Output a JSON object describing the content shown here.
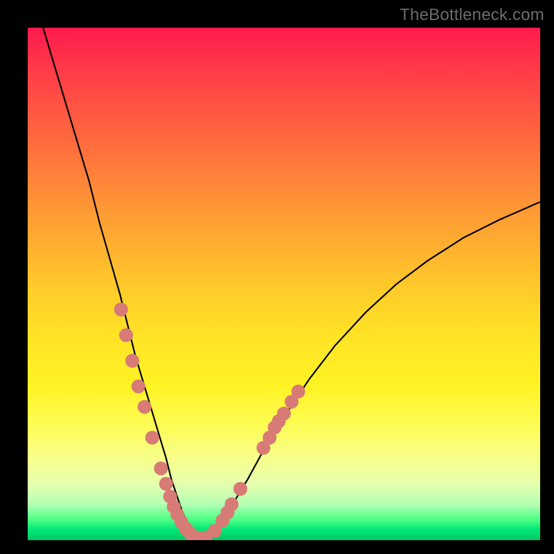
{
  "watermark": "TheBottleneck.com",
  "chart_data": {
    "type": "line",
    "title": "",
    "xlabel": "",
    "ylabel": "",
    "xlim": [
      0,
      100
    ],
    "ylim": [
      0,
      100
    ],
    "grid": false,
    "legend": false,
    "series": [
      {
        "name": "curve",
        "x": [
          3,
          6,
          9,
          12,
          14,
          16,
          18,
          19.5,
          21,
          22.5,
          24,
          25.5,
          27,
          28,
          29,
          30,
          31,
          32,
          33,
          34.5,
          36,
          38,
          40,
          43,
          46,
          50,
          55,
          60,
          66,
          72,
          78,
          85,
          92,
          100
        ],
        "y": [
          100,
          90,
          80,
          70,
          62,
          55,
          48,
          42,
          36,
          31,
          26,
          21,
          16,
          12,
          9,
          6,
          3.5,
          1.8,
          0.7,
          0.7,
          1.8,
          4,
          7,
          12,
          17.5,
          24,
          31.5,
          38,
          44.5,
          50,
          54.5,
          59,
          62.5,
          66
        ],
        "color": "#000000"
      }
    ],
    "points": [
      {
        "name": "markers",
        "color": "#d87a76",
        "data": [
          {
            "x": 18.2,
            "y": 45
          },
          {
            "x": 19.2,
            "y": 40
          },
          {
            "x": 20.4,
            "y": 35
          },
          {
            "x": 21.6,
            "y": 30
          },
          {
            "x": 22.8,
            "y": 26
          },
          {
            "x": 24.3,
            "y": 20
          },
          {
            "x": 26.0,
            "y": 14
          },
          {
            "x": 27.0,
            "y": 11
          },
          {
            "x": 27.8,
            "y": 8.5
          },
          {
            "x": 28.5,
            "y": 6.5
          },
          {
            "x": 29.2,
            "y": 5
          },
          {
            "x": 30.0,
            "y": 3.5
          },
          {
            "x": 30.9,
            "y": 2.2
          },
          {
            "x": 31.8,
            "y": 1.2
          },
          {
            "x": 32.7,
            "y": 0.6
          },
          {
            "x": 33.7,
            "y": 0.4
          },
          {
            "x": 34.7,
            "y": 0.5
          },
          {
            "x": 36.5,
            "y": 1.8
          },
          {
            "x": 38.0,
            "y": 3.8
          },
          {
            "x": 39.0,
            "y": 5.4
          },
          {
            "x": 39.8,
            "y": 7.0
          },
          {
            "x": 41.5,
            "y": 10
          },
          {
            "x": 46.0,
            "y": 18
          },
          {
            "x": 47.2,
            "y": 20
          },
          {
            "x": 48.2,
            "y": 22
          },
          {
            "x": 49.0,
            "y": 23.2
          },
          {
            "x": 50.0,
            "y": 24.7
          },
          {
            "x": 51.5,
            "y": 27
          },
          {
            "x": 52.8,
            "y": 29
          }
        ]
      }
    ]
  }
}
